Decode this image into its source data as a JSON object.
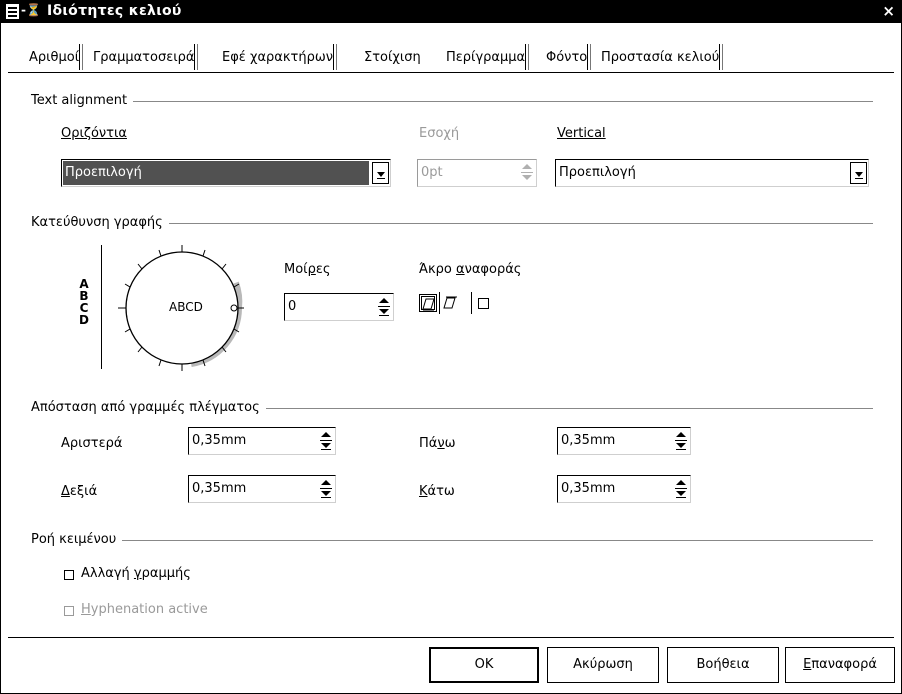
{
  "window": {
    "title": "Ιδιότητες κελιού",
    "title_icon": "document-icon",
    "title_symbol": "-⏳",
    "close_glyph": "×"
  },
  "tabs": [
    {
      "label": "Αριθμοί"
    },
    {
      "label": "Γραμματοσειρά"
    },
    {
      "label": "Εφέ χαρακτήρων"
    },
    {
      "label": "Στοίχιση",
      "active": true
    },
    {
      "label": "Περίγραμμα"
    },
    {
      "label": "Φόντο"
    },
    {
      "label": "Προστασία κελιού"
    }
  ],
  "text_alignment": {
    "group_label": "Text alignment",
    "horizontal_label": "Οριζόντια",
    "horizontal_value": "Προεπιλογή",
    "indent_label": "Εσοχή",
    "indent_value": "0pt",
    "vertical_label": "Vertical",
    "vertical_value": "Προεπιλογή"
  },
  "writing_direction": {
    "group_label": "Κατεύθυνση γραφής",
    "stacked_letters": [
      "A",
      "B",
      "C",
      "D"
    ],
    "dial_text": "ABCD",
    "degrees_label": "Μοίρες",
    "degrees_value": "0",
    "reference_edge_label": "Άκρο αναφοράς"
  },
  "grid_spacing": {
    "group_label": "Απόσταση από γραμμές πλέγματος",
    "left_label": "Αριστερά",
    "left_value": "0,35mm",
    "right_label": "Δεξιά",
    "right_value": "0,35mm",
    "top_label": "Πάνω",
    "top_value": "0,35mm",
    "bottom_label": "Κάτω",
    "bottom_value": "0,35mm"
  },
  "text_flow": {
    "group_label": "Ροή κειμένου",
    "line_break_label": "Αλλαγή γραμμής",
    "hyphenation_label": "Hyphenation active"
  },
  "buttons": {
    "ok": "OK",
    "cancel": "Ακύρωση",
    "help": "Βοήθεια",
    "reset": "Επαναφορά"
  },
  "colors": {
    "titlebar": "#000000",
    "selection": "#515151",
    "disabled": "#9a9a9a"
  }
}
